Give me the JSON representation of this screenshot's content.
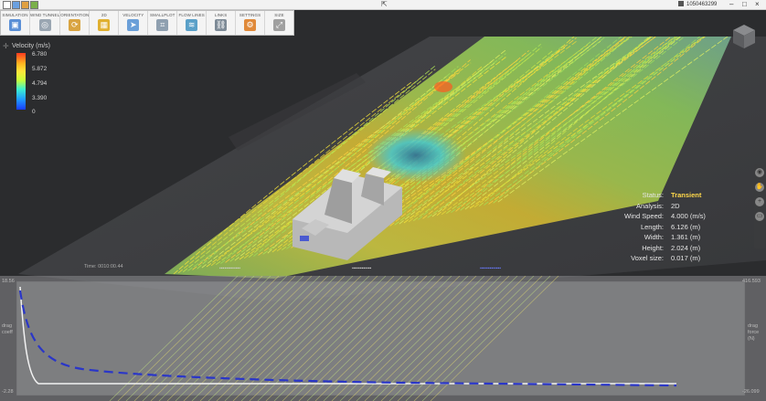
{
  "user": "1050463299",
  "ribbon": {
    "items": [
      {
        "label": "SIMULATION",
        "icon": "simulation-icon",
        "color": "#5a8fd6"
      },
      {
        "label": "WIND TUNNEL",
        "icon": "wind-tunnel-icon",
        "color": "#9aa6b2"
      },
      {
        "label": "ORIENTATION",
        "icon": "orientation-icon",
        "color": "#d9a441"
      },
      {
        "label": "2D",
        "icon": "2d-view-icon",
        "color": "#e0b030"
      },
      {
        "label": "VELOCITY",
        "icon": "velocity-icon",
        "color": "#6a9fd8"
      },
      {
        "label": "SMALLPLOT",
        "icon": "smallplot-icon",
        "color": "#8fa0b0"
      },
      {
        "label": "FLOW LINES",
        "icon": "flow-lines-icon",
        "color": "#5aa0c8"
      },
      {
        "label": "LINKS",
        "icon": "links-icon",
        "color": "#7d8a96"
      },
      {
        "label": "SETTINGS",
        "icon": "settings-icon",
        "color": "#e08a3a"
      },
      {
        "label": "SIZE",
        "icon": "size-icon",
        "color": "#a0a0a0"
      }
    ]
  },
  "legend": {
    "title": "Velocity (m/s)",
    "ticks": [
      "6.780",
      "5.872",
      "4.794",
      "3.390",
      "0"
    ]
  },
  "status_panel": [
    {
      "key": "Status:",
      "value": "Transient",
      "highlight": true
    },
    {
      "key": "Analysis:",
      "value": "2D",
      "highlight": false
    },
    {
      "key": "Wind Speed:",
      "value": "4.000 (m/s)",
      "highlight": false
    },
    {
      "key": "Length:",
      "value": "6.126 (m)",
      "highlight": false
    },
    {
      "key": "Width:",
      "value": "1.361 (m)",
      "highlight": false
    },
    {
      "key": "Height:",
      "value": "2.024 (m)",
      "highlight": false
    },
    {
      "key": "Voxel size:",
      "value": "0.017 (m)",
      "highlight": false
    }
  ],
  "time_label": "Time: 0010:00.44",
  "graph": {
    "left_top": "18.56",
    "left_bottom": "-2.28",
    "right_top": "416.593",
    "right_bottom": "-26.099",
    "left_label": "drag coeff",
    "right_label": "drag force (N)"
  },
  "colors": {
    "accent_status": "#ffd84a",
    "drag_coeff_line": "#e8e8e8",
    "drag_force_line": "#2a36c8"
  }
}
